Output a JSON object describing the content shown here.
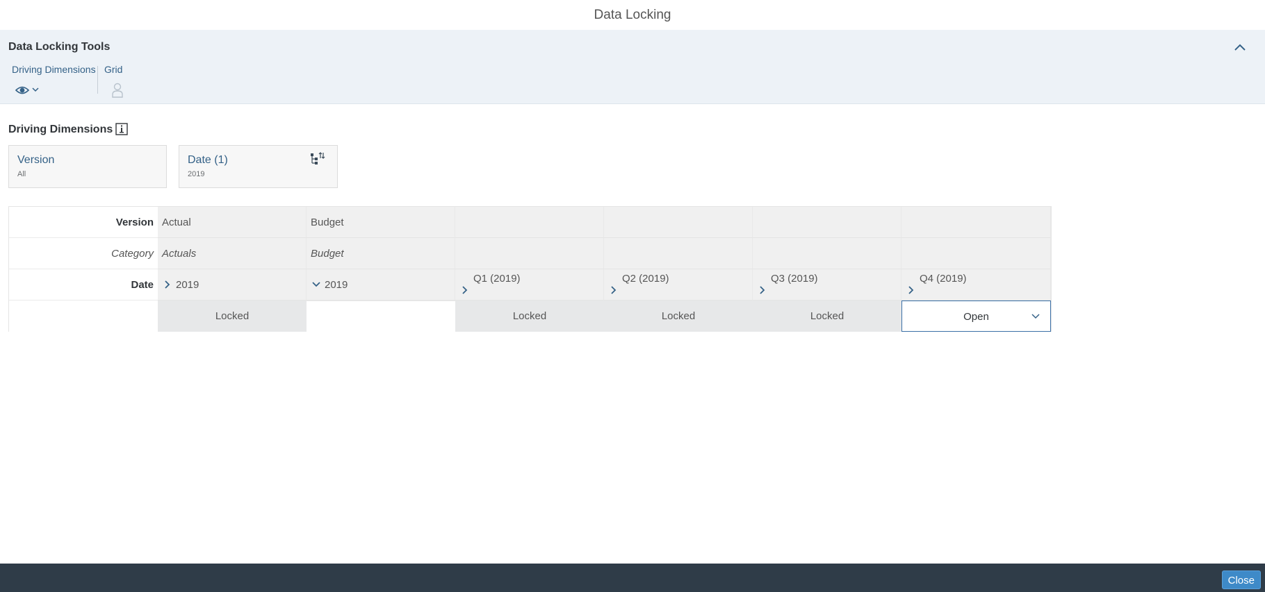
{
  "dialog": {
    "title": "Data Locking"
  },
  "tools": {
    "title": "Data Locking Tools",
    "driving_dimensions_label": "Driving Dimensions",
    "grid_label": "Grid"
  },
  "section": {
    "title": "Driving Dimensions"
  },
  "dimensions": [
    {
      "name": "Version",
      "value": "All"
    },
    {
      "name": "Date (1)",
      "value": "2019"
    }
  ],
  "grid": {
    "row_labels": {
      "version": "Version",
      "category": "Category",
      "date": "Date"
    },
    "versions": [
      "Actual",
      "Budget"
    ],
    "categories": [
      "Actuals",
      "Budget"
    ],
    "dates": [
      "2019",
      "2019",
      "Q1 (2019)",
      "Q2 (2019)",
      "Q3 (2019)",
      "Q4 (2019)"
    ],
    "states": [
      "Locked",
      "",
      "Locked",
      "Locked",
      "Locked",
      "Open"
    ]
  },
  "footer": {
    "close_label": "Close"
  },
  "colors": {
    "accent": "#346187",
    "footer_bg": "#2f3c48",
    "button": "#3e8ac8"
  }
}
